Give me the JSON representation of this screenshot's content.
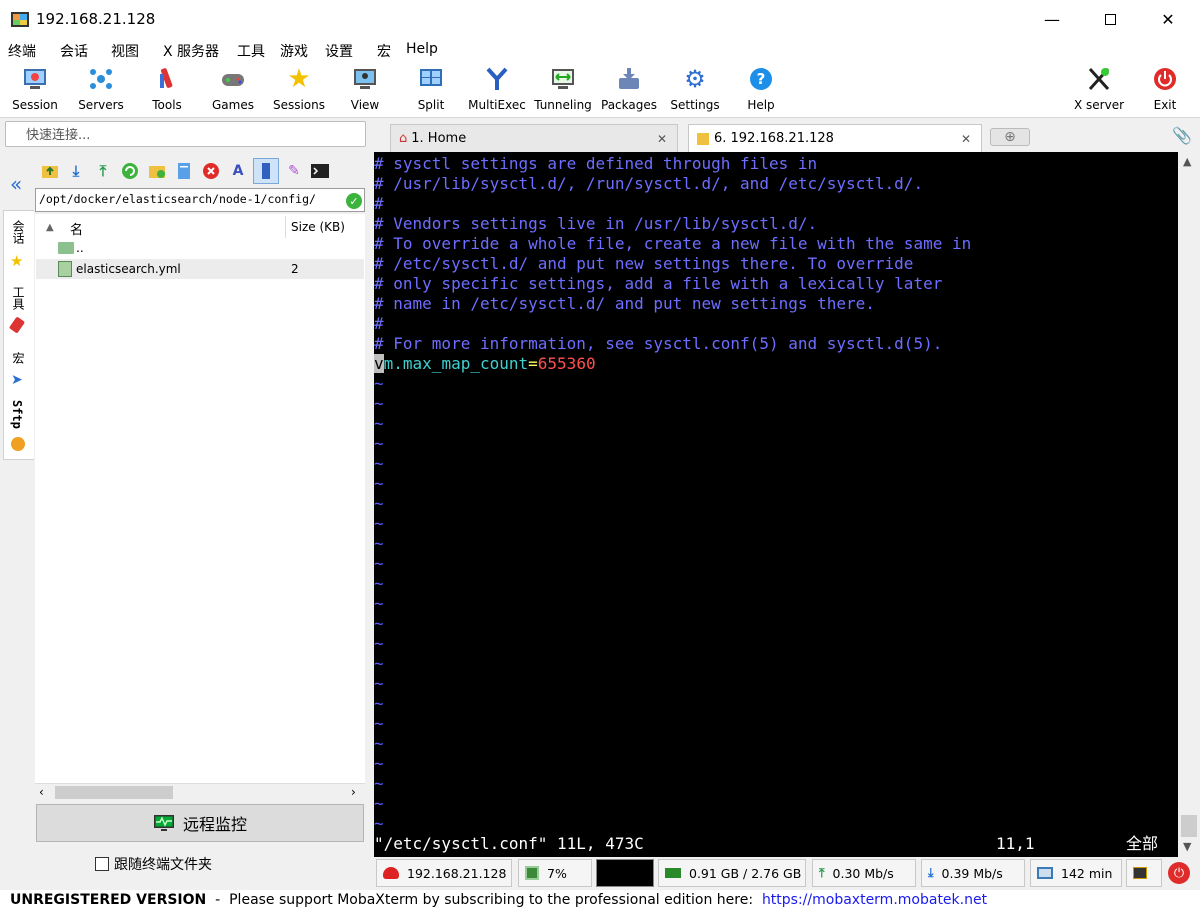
{
  "window": {
    "title": "192.168.21.128"
  },
  "menu": [
    "终端",
    "会话",
    "视图",
    "X 服务器",
    "工具",
    "游戏",
    "设置",
    "宏",
    "Help"
  ],
  "toolbar": {
    "items": [
      "Session",
      "Servers",
      "Tools",
      "Games",
      "Sessions",
      "View",
      "Split",
      "MultiExec",
      "Tunneling",
      "Packages",
      "Settings",
      "Help"
    ],
    "xserver": "X server",
    "exit": "Exit"
  },
  "quick_connect": {
    "placeholder": "快速连接..."
  },
  "side_tabs": [
    "会话",
    "工具",
    "宏",
    "Sftp"
  ],
  "sftp": {
    "path": "/opt/docker/elasticsearch/node-1/config/",
    "col_name": "名",
    "col_size": "Size (KB)",
    "files": [
      {
        "name": "..",
        "size": ""
      },
      {
        "name": "elasticsearch.yml",
        "size": "2"
      }
    ],
    "monitor_button": "远程监控",
    "follow_label": "跟随终端文件夹"
  },
  "tabs": [
    {
      "label": "1. Home"
    },
    {
      "label": "6. 192.168.21.128"
    }
  ],
  "terminal": {
    "comments": [
      "# sysctl settings are defined through files in",
      "# /usr/lib/sysctl.d/, /run/sysctl.d/, and /etc/sysctl.d/.",
      "#",
      "# Vendors settings live in /usr/lib/sysctl.d/.",
      "# To override a whole file, create a new file with the same in",
      "# /etc/sysctl.d/ and put new settings there. To override",
      "# only specific settings, add a file with a lexically later",
      "# name in /etc/sysctl.d/ and put new settings there.",
      "#",
      "# For more information, see sysctl.conf(5) and sysctl.d(5)."
    ],
    "setting_cursor": "v",
    "setting_key": "m.max_map_count",
    "setting_eq": "=",
    "setting_value": "655360",
    "tilde": "~",
    "status_file": "\"/etc/sysctl.conf\" 11L, 473C",
    "status_pos": "11,1",
    "status_all": "全部"
  },
  "statusbar": {
    "host": "192.168.21.128",
    "cpu": "7%",
    "memory": "0.91 GB / 2.76 GB",
    "upload": "0.30 Mb/s",
    "download": "0.39 Mb/s",
    "uptime": "142 min"
  },
  "footer": {
    "unregistered": "UNREGISTERED VERSION",
    "message": "  -  Please support MobaXterm by subscribing to the professional edition here:  ",
    "link": "https://mobaxterm.mobatek.net"
  },
  "colors": {
    "comment": "#6d6dff",
    "key": "#40d0d0",
    "value": "#ff5050",
    "eq": "#ffff60"
  }
}
